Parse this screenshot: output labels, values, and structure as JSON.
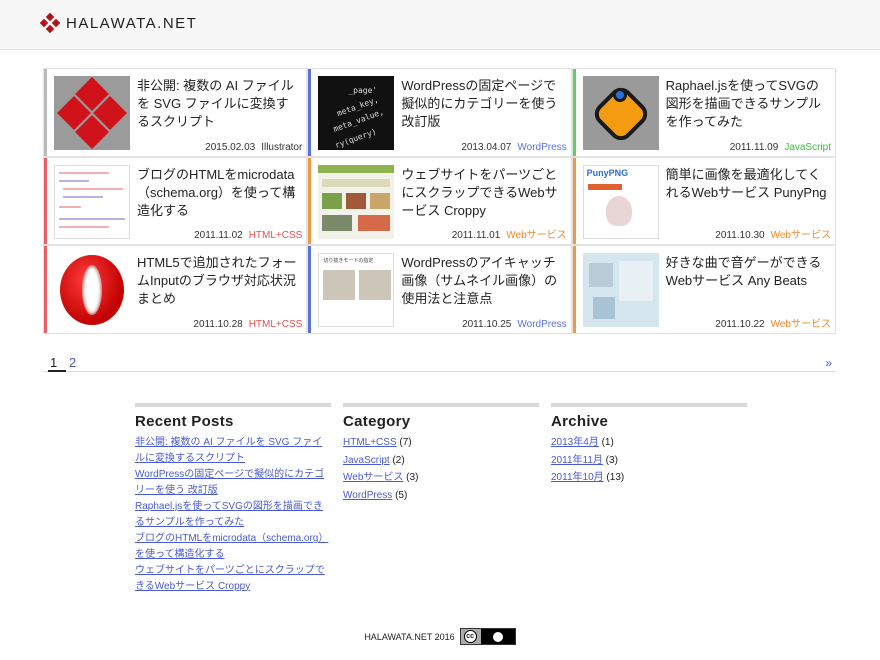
{
  "site": {
    "name": "HALAWATA.NET"
  },
  "posts": [
    {
      "title": "非公開: 複数の AI ファイルを SVG ファイルに変換するスクリプト",
      "date": "2015.02.03",
      "category": "Illustrator",
      "thumb": "illustrator-diamonds"
    },
    {
      "title": "WordPressの固定ページで擬似的にカテゴリーを使う 改訂版",
      "date": "2013.04.07",
      "category": "WordPress",
      "thumb": "code-screenshot"
    },
    {
      "title": "Raphael.jsを使ってSVGの図形を描画できるサンプルを作ってみた",
      "date": "2011.11.09",
      "category": "JavaScript",
      "thumb": "raphael-logo"
    },
    {
      "title": "ブログのHTMLをmicrodata（schema.org）を使って構造化する",
      "date": "2011.11.02",
      "category": "HTML+CSS",
      "thumb": "html-code"
    },
    {
      "title": "ウェブサイトをパーツごとにスクラップできるWebサービス Croppy",
      "date": "2011.11.01",
      "category": "Webサービス",
      "thumb": "croppy-screenshot"
    },
    {
      "title": "簡単に画像を最適化してくれるWebサービス PunyPng",
      "date": "2011.10.30",
      "category": "Webサービス",
      "thumb": "punypng-screenshot"
    },
    {
      "title": "HTML5で追加されたフォームInputのブラウザ対応状況まとめ",
      "date": "2011.10.28",
      "category": "HTML+CSS",
      "thumb": "opera-logo"
    },
    {
      "title": "WordPressのアイキャッチ画像（サムネイル画像）の使用法と注意点",
      "date": "2011.10.25",
      "category": "WordPress",
      "thumb": "eyecatch-sample"
    },
    {
      "title": "好きな曲で音ゲーができるWebサービス Any Beats",
      "date": "2011.10.22",
      "category": "Webサービス",
      "thumb": "anybeats-screenshot"
    }
  ],
  "pagination": {
    "current": "1",
    "next_page": "2",
    "next_arrow": "»"
  },
  "thumb_text": {
    "code": [
      "_page'",
      "meta_key,",
      "meta_value,",
      "ry(query)"
    ],
    "puny": "PunyPNG",
    "eyecatch": "切り抜きモードの指定"
  },
  "widgets": {
    "recent": {
      "title": "Recent Posts",
      "items": [
        "非公開: 複数の AI ファイルを SVG ファイルに変換するスクリプト",
        "WordPressの固定ページで擬似的にカテゴリーを使う 改訂版",
        "Raphael.jsを使ってSVGの図形を描画できるサンプルを作ってみた",
        "ブログのHTMLをmicrodata（schema.org）を使って構造化する",
        "ウェブサイトをパーツごとにスクラップできるWebサービス Croppy"
      ]
    },
    "category": {
      "title": "Category",
      "items": [
        {
          "label": "HTML+CSS",
          "count": "(7)"
        },
        {
          "label": "JavaScript",
          "count": "(2)"
        },
        {
          "label": "Webサービス",
          "count": "(3)"
        },
        {
          "label": "WordPress",
          "count": "(5)"
        }
      ]
    },
    "archive": {
      "title": "Archive",
      "items": [
        {
          "label": "2013年4月",
          "count": "(1)"
        },
        {
          "label": "2011年11月",
          "count": "(3)"
        },
        {
          "label": "2011年10月",
          "count": "(13)"
        }
      ]
    }
  },
  "footer": {
    "copyright": "HALAWATA.NET 2016",
    "license_c": "cc",
    "license_icon": "creative-commons-by-icon"
  },
  "colors": {
    "brand": "#b0121b",
    "link": "#4a5bd0",
    "wordpress": "#5a73d8",
    "javascript": "#3fbf3f",
    "htmlcss": "#e05050",
    "webservice": "#ec8a30"
  }
}
